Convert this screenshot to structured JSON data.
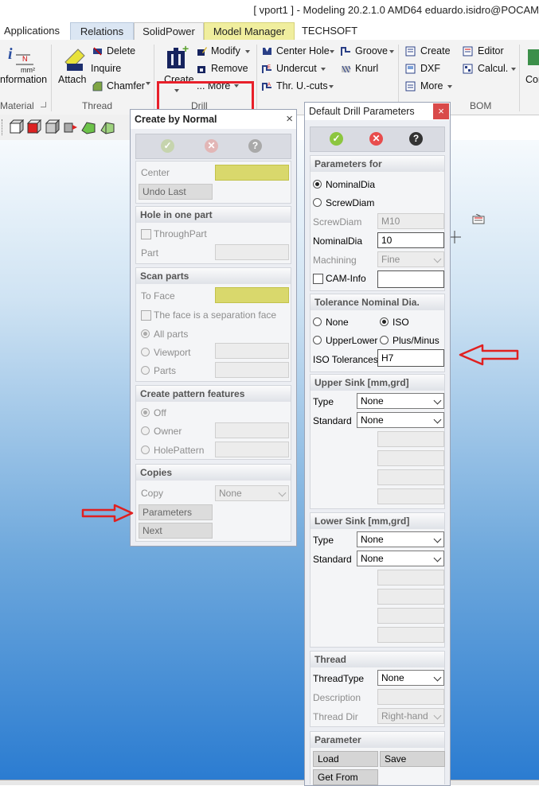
{
  "window": {
    "title": "[ vport1 ] - Modeling 20.2.1.0 AMD64 eduardo.isidro@POCAM"
  },
  "tabs": [
    "Applications",
    "Relations",
    "SolidPower",
    "Model Manager",
    "TECHSOFT"
  ],
  "ribbon": {
    "material": {
      "information": "nformation",
      "label": "Material"
    },
    "thread": {
      "attach": "Attach",
      "delete": "Delete",
      "inquire": "Inquire",
      "chamfer": "Chamfer",
      "label": "Thread"
    },
    "drill": {
      "create": "Create",
      "modify": "Modify",
      "remove": "Remove",
      "more": "... More",
      "label": "Drill"
    },
    "hole": {
      "center_hole": "Center Hole",
      "undercut": "Undercut",
      "thr_ucuts": "Thr. U.-cuts",
      "groove": "Groove",
      "knurl": "Knurl"
    },
    "bom": {
      "create": "Create",
      "dxf": "DXF",
      "more": "More",
      "editor": "Editor",
      "calcul": "Calcul.",
      "label": "BOM",
      "cor": "Cor"
    }
  },
  "create_by_normal": {
    "title": "Create by Normal",
    "center_label": "Center",
    "undo_last": "Undo Last",
    "hole_section": {
      "title": "Hole in one part",
      "throughpart": "ThroughPart",
      "part": "Part"
    },
    "scan_section": {
      "title": "Scan parts",
      "to_face": "To Face",
      "separation": "The face is a separation face",
      "all_parts": "All parts",
      "viewport": "Viewport",
      "parts": "Parts"
    },
    "pattern_section": {
      "title": "Create pattern features",
      "off": "Off",
      "owner": "Owner",
      "holepattern": "HolePattern"
    },
    "copies_section": {
      "title": "Copies",
      "copy": "Copy",
      "copy_value": "None",
      "parameters": "Parameters",
      "next": "Next"
    }
  },
  "default_drill": {
    "title": "Default Drill Parameters",
    "params_for": {
      "title": "Parameters for",
      "nominaldia": "NominalDia",
      "screwdiam": "ScrewDiam",
      "screwdiam_label": "ScrewDiam",
      "screwdiam_value": "M10",
      "nominaldia_label": "NominalDia",
      "nominaldia_value": "10",
      "machining": "Machining",
      "machining_value": "Fine",
      "cam_info": "CAM-Info"
    },
    "tolerance": {
      "title": "Tolerance Nominal Dia.",
      "none": "None",
      "iso": "ISO",
      "upperlower": "UpperLower",
      "plusminus": "Plus/Minus",
      "iso_tol_label": "ISO Tolerances",
      "iso_tol_value": "H7"
    },
    "upper_sink": {
      "title": "Upper Sink [mm,grd]",
      "type": "Type",
      "type_value": "None",
      "standard": "Standard",
      "standard_value": "None"
    },
    "lower_sink": {
      "title": "Lower Sink [mm,grd]",
      "type": "Type",
      "type_value": "None",
      "standard": "Standard",
      "standard_value": "None"
    },
    "thread": {
      "title": "Thread",
      "threadtype": "ThreadType",
      "threadtype_value": "None",
      "description": "Description",
      "thread_dir": "Thread Dir",
      "thread_dir_value": "Right-hand"
    },
    "parameter": {
      "title": "Parameter",
      "load": "Load",
      "save": "Save",
      "get_from": "Get From"
    }
  },
  "colors": {
    "highlight_red": "#e8202a",
    "annotation_arrow": "#e02020",
    "field_yellow": "#d9d86c",
    "ok_green": "#8cc63f",
    "cancel_red": "#e84c4c"
  }
}
